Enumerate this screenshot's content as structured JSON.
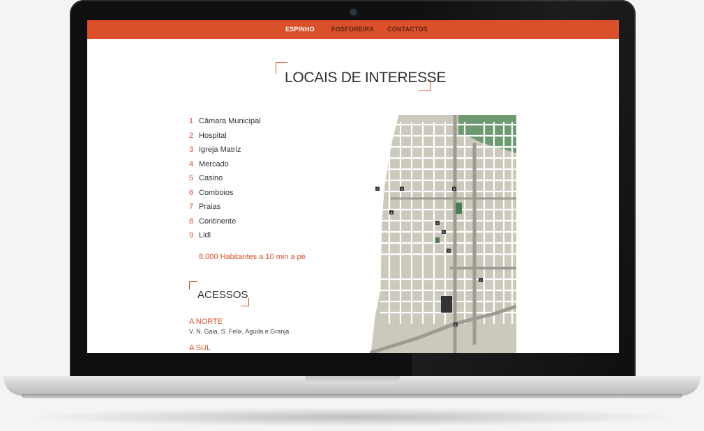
{
  "nav": {
    "items": [
      {
        "label": "ESPINHO",
        "active": true
      },
      {
        "label": "FOSFOREIRA",
        "active": false
      },
      {
        "label": "CONTACTOS",
        "active": false
      }
    ]
  },
  "page": {
    "title": "LOCAIS DE INTERESSE",
    "places": [
      {
        "num": "1",
        "name": "Câmara Municipal"
      },
      {
        "num": "2",
        "name": "Hospital"
      },
      {
        "num": "3",
        "name": "Igreja Matriz"
      },
      {
        "num": "4",
        "name": "Mercado"
      },
      {
        "num": "5",
        "name": "Casino"
      },
      {
        "num": "6",
        "name": "Comboios"
      },
      {
        "num": "7",
        "name": "Praias"
      },
      {
        "num": "8",
        "name": "Continente"
      },
      {
        "num": "9",
        "name": "Lidl"
      }
    ],
    "stat": "8.000 Habitantes a 10 min a pé"
  },
  "acessos": {
    "title": "ACESSOS",
    "norte": {
      "title": "A NORTE",
      "desc": "V. N. Gaia, S. Felix, Aguda e Granja"
    },
    "sul": {
      "title": "A SUL"
    }
  },
  "map": {
    "markers": [
      "1",
      "2",
      "3",
      "4",
      "5",
      "6",
      "7",
      "8",
      "9"
    ],
    "colors": {
      "land": "#cbc8bc",
      "road": "#ffffff",
      "park": "#6e9a72",
      "main_road": "#9e9b92",
      "marker": "#3a3a3a"
    }
  },
  "colors": {
    "accent": "#d9502b",
    "text": "#2d2d2d",
    "nav_inactive": "#5e2412"
  }
}
